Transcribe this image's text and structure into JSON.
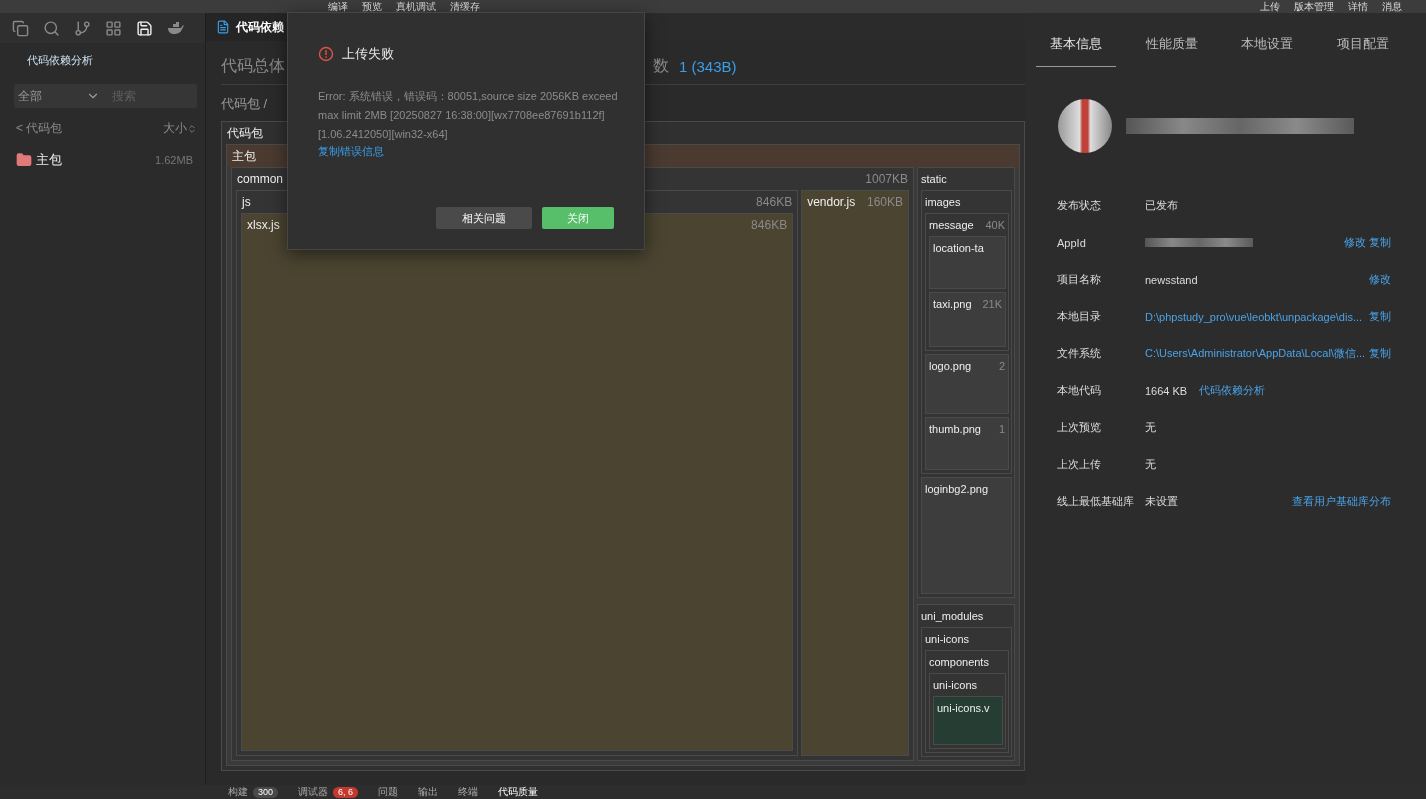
{
  "top_bar": {
    "left_actions": [
      "编译",
      "预览",
      "真机调试",
      "清缓存"
    ],
    "right_actions": [
      "上传",
      "版本管理",
      "详情",
      "消息"
    ]
  },
  "activity_bar": [
    {
      "kind": "copy",
      "selected": false
    },
    {
      "kind": "search",
      "selected": false
    },
    {
      "kind": "branch",
      "selected": false
    },
    {
      "kind": "extensions",
      "selected": false
    },
    {
      "kind": "save",
      "selected": true
    },
    {
      "kind": "whale",
      "selected": false
    }
  ],
  "sidebar": {
    "title": "代码依赖分析",
    "filter": {
      "value": "全部"
    },
    "search": {
      "placeholder": "搜索"
    },
    "back_label": "< 代码包",
    "sort_label": "大小",
    "items": [
      {
        "name": "主包",
        "size": "1.62MB"
      }
    ]
  },
  "editor_tab": {
    "title": "代码依赖"
  },
  "summary": {
    "heading_start": "代码总体",
    "heading_end": "数",
    "count": "1 (343B)"
  },
  "breadcrumb": "代码包 /",
  "treemap": {
    "name": "代码包",
    "kind": "root",
    "children": [
      {
        "name": "主包",
        "kind": "package",
        "children": [
          {
            "name": "common",
            "size": "1007KB",
            "kind": "folder",
            "children": [
              {
                "name": "js",
                "size": "846KB",
                "kind": "folder",
                "children": [
                  {
                    "name": "xlsx.js",
                    "size": "846KB",
                    "kind": "js"
                  }
                ]
              },
              {
                "name": "vendor.js",
                "size": "160KB",
                "kind": "js"
              }
            ]
          },
          {
            "name": "static",
            "kind": "folder",
            "children": [
              {
                "name": "images",
                "kind": "folder",
                "children": [
                  {
                    "name": "message",
                    "size": "40K",
                    "kind": "folder",
                    "children": [
                      {
                        "name": "location-ta",
                        "kind": "image"
                      },
                      {
                        "name": "taxi.png",
                        "size": "21K",
                        "kind": "image"
                      }
                    ]
                  },
                  {
                    "name": "logo.png",
                    "size": "2",
                    "kind": "image"
                  },
                  {
                    "name": "thumb.png",
                    "size": "1",
                    "kind": "image"
                  }
                ]
              },
              {
                "name": "loginbg2.png",
                "kind": "image"
              }
            ]
          },
          {
            "name": "uni_modules",
            "kind": "folder",
            "children": [
              {
                "name": "uni-icons",
                "kind": "folder",
                "children": [
                  {
                    "name": "components",
                    "kind": "folder",
                    "children": [
                      {
                        "name": "uni-icons",
                        "kind": "folder",
                        "children": [
                          {
                            "name": "uni-icons.v",
                            "kind": "vue"
                          }
                        ]
                      }
                    ]
                  }
                ]
              }
            ]
          }
        ]
      }
    ]
  },
  "dialog": {
    "title": "上传失败",
    "message": "Error: 系统错误，错误码：80051,source size 2056KB exceed max limit 2MB [20250827 16:38:00][wx7708ee87691b112f] [1.06.2412050][win32-x64]",
    "link": "复制错误信息",
    "buttons": [
      {
        "label": "相关问题",
        "kind": "secondary"
      },
      {
        "label": "关闭",
        "kind": "primary"
      }
    ]
  },
  "right_panel": {
    "tabs": [
      {
        "label": "基本信息",
        "selected": true
      },
      {
        "label": "性能质量",
        "selected": false
      },
      {
        "label": "本地设置",
        "selected": false
      },
      {
        "label": "项目配置",
        "selected": false
      }
    ],
    "rows": [
      {
        "label": "发布状态",
        "value": "已发布",
        "kind": "text"
      },
      {
        "label": "AppId",
        "kind": "redacted",
        "actions": [
          "修改",
          "复制"
        ]
      },
      {
        "label": "项目名称",
        "value": "newsstand",
        "kind": "text",
        "actions": [
          "修改"
        ]
      },
      {
        "label": "本地目录",
        "value": "D:\\phpstudy_pro\\vue\\leobkt\\unpackage\\dis...",
        "kind": "link",
        "actions": [
          "复制"
        ]
      },
      {
        "label": "文件系统",
        "value": "C:\\Users\\Administrator\\AppData\\Local\\微信...",
        "kind": "link",
        "actions": [
          "复制"
        ]
      },
      {
        "label": "本地代码",
        "value": "1664 KB",
        "kind": "text",
        "inline_link": "代码依赖分析"
      },
      {
        "label": "上次预览",
        "value": "无",
        "kind": "text"
      },
      {
        "label": "上次上传",
        "value": "无",
        "kind": "text"
      },
      {
        "label": "线上最低基础库",
        "value": "未设置",
        "kind": "text",
        "actions": [
          "查看用户基础库分布"
        ]
      }
    ]
  },
  "bottom_tabs": [
    {
      "label": "构建",
      "badge": {
        "text": "300",
        "kind": "neutral"
      },
      "selected": false
    },
    {
      "label": "调试器",
      "badge": {
        "text": "6, 6",
        "kind": "error"
      },
      "selected": false
    },
    {
      "label": "问题",
      "selected": false
    },
    {
      "label": "输出",
      "selected": false
    },
    {
      "label": "终端",
      "selected": false
    },
    {
      "label": "代码质量",
      "selected": true
    }
  ]
}
